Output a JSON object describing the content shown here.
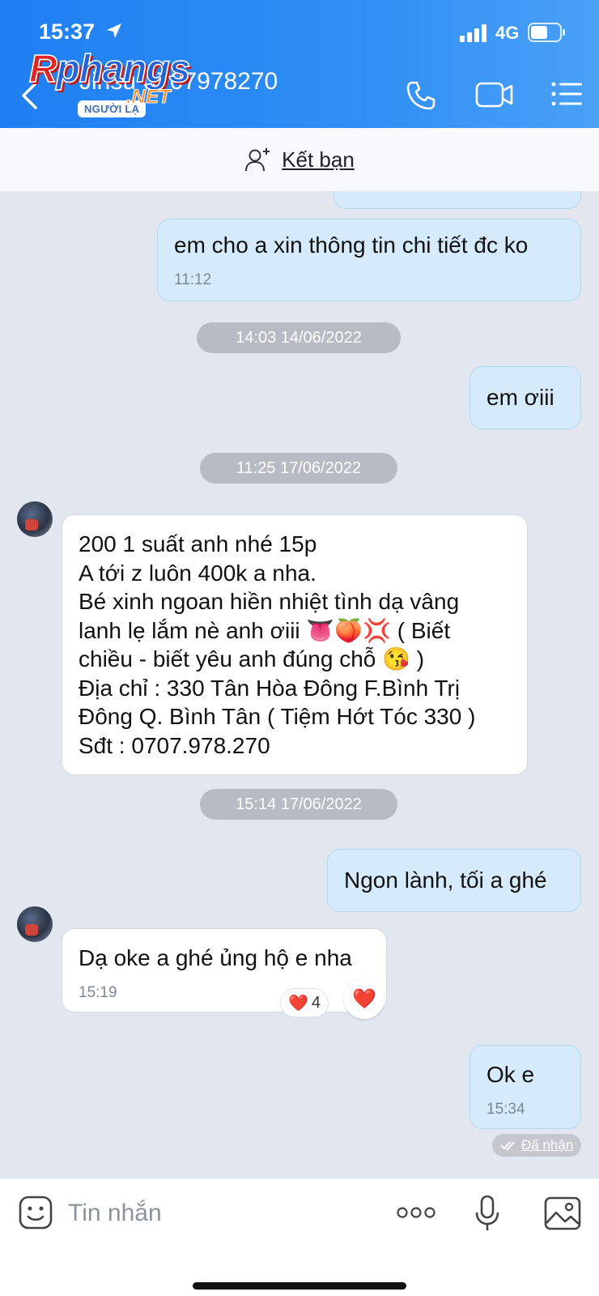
{
  "status_bar": {
    "time": "15:37",
    "network": "4G"
  },
  "header": {
    "contact_name": "Jinsu 0707978270",
    "badge": "NGƯỜI LẠ",
    "watermark_main": "phangs",
    "watermark_r": "R",
    "watermark_sub": ".NET"
  },
  "friend_bar": {
    "label": "Kết bạn"
  },
  "messages": [
    {
      "text": "em cho a xin thông tin chi tiết đc ko",
      "time": "11:12"
    },
    {
      "date": "14:03 14/06/2022"
    },
    {
      "text": "em ơiii"
    },
    {
      "date": "11:25 17/06/2022"
    },
    {
      "lines": [
        "200 1 suất anh nhé 15p",
        "A tới z luôn 400k a nha.",
        "Bé xinh ngoan hiền nhiệt tình dạ vâng",
        "lanh lẹ lắm nè anh ơiii 👅🍑💢 ( Biết",
        "chiều - biết yêu anh đúng chỗ 😘 )",
        "Địa chỉ : 330 Tân Hòa Đông  F.Bình Trị",
        "Đông Q. Bình Tân ( Tiệm Hớt Tóc 330 )",
        "Sđt : 0707.978.270"
      ]
    },
    {
      "date": "15:14 17/06/2022"
    },
    {
      "text": "Ngon lành, tối a ghé"
    },
    {
      "text": "Dạ oke a ghé ủng hộ e nha",
      "time": "15:19",
      "reaction": "❤️",
      "reaction_count": "4"
    },
    {
      "text": "Ok e",
      "time": "15:34",
      "status": "Đã nhận"
    }
  ],
  "input": {
    "placeholder": "Tin nhắn"
  },
  "colors": {
    "header_blue": "#2487f3",
    "outgoing_bubble": "#d5ebfc",
    "incoming_bubble": "#ffffff",
    "chat_bg": "#e2e7ef"
  },
  "icons": [
    "location-arrow-icon",
    "signal-icon",
    "battery-icon",
    "back-icon",
    "phone-icon",
    "video-icon",
    "menu-icon",
    "add-friend-icon",
    "sticker-icon",
    "more-icon",
    "mic-icon",
    "image-icon",
    "double-check-icon"
  ]
}
